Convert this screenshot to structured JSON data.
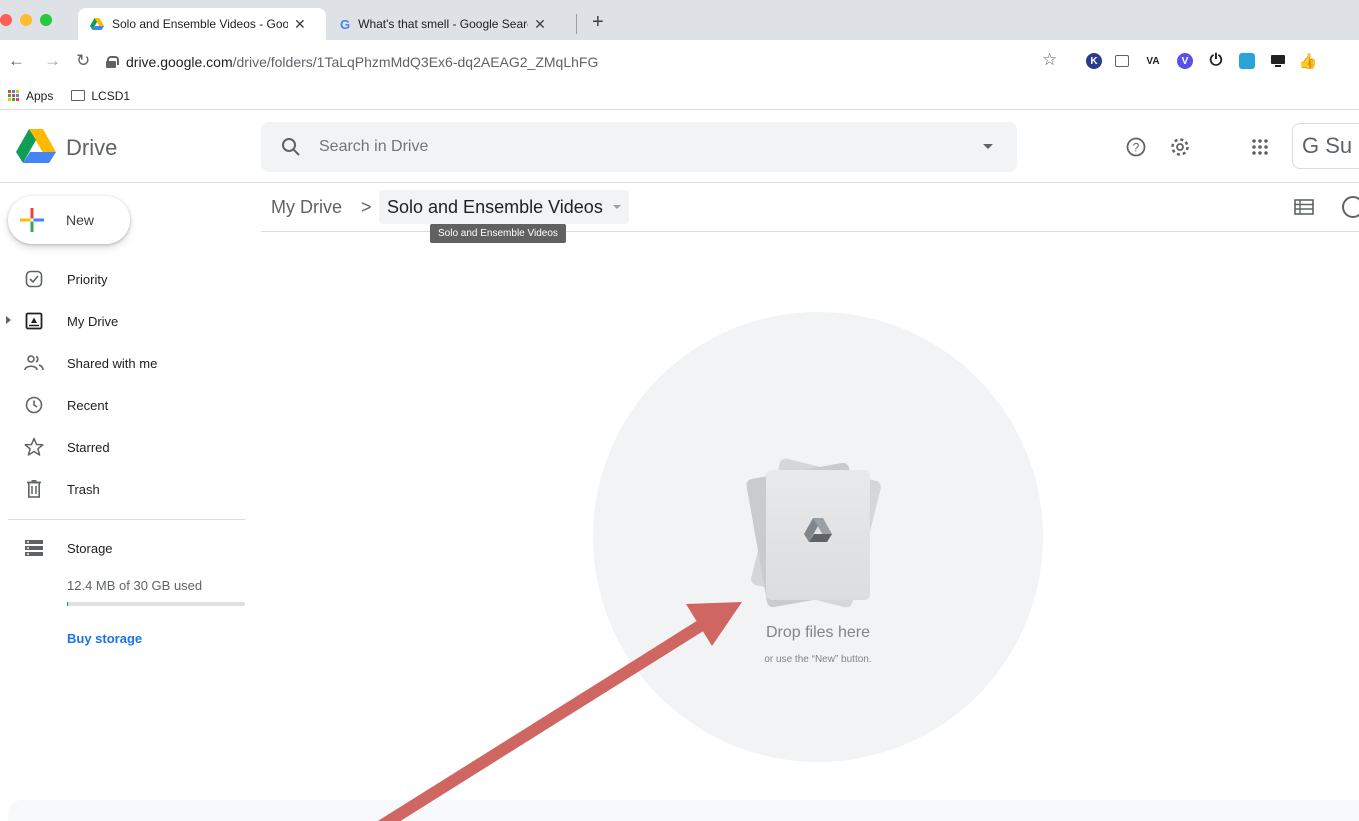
{
  "browser": {
    "tabs": [
      {
        "title": "Solo and Ensemble Videos - Google Drive",
        "active": true
      },
      {
        "title": "What's that smell - Google Search",
        "active": false
      }
    ],
    "url_host": "drive.google.com",
    "url_path": "/drive/folders/1TaLqPhzmMdQ3Ex6-dq2AEAG2_ZMqLhFG",
    "extensions": [
      "K",
      "mail-icon",
      "VA",
      "V",
      "power-icon",
      "cloud-icon",
      "screen-icon",
      "thumb-icon"
    ]
  },
  "bookmarks": {
    "apps_label": "Apps",
    "folder_label": "LCSD1"
  },
  "header": {
    "title": "Drive",
    "search_placeholder": "Search in Drive",
    "gsuite_label": "G Su"
  },
  "sidebar": {
    "new_label": "New",
    "items": [
      {
        "label": "Priority",
        "icon": "priority-icon"
      },
      {
        "label": "My Drive",
        "icon": "my-drive-icon"
      },
      {
        "label": "Shared with me",
        "icon": "shared-icon"
      },
      {
        "label": "Recent",
        "icon": "clock-icon"
      },
      {
        "label": "Starred",
        "icon": "star-icon"
      },
      {
        "label": "Trash",
        "icon": "trash-icon"
      }
    ],
    "storage_label": "Storage",
    "storage_used": "12.4 MB of 30 GB used",
    "storage_fraction": 0.0004,
    "buy_label": "Buy storage"
  },
  "breadcrumb": {
    "root": "My Drive",
    "separator": ">",
    "current": "Solo and Ensemble Videos",
    "tooltip": "Solo and Ensemble Videos"
  },
  "empty_state": {
    "title": "Drop files here",
    "subtitle": "or use the “New” button."
  },
  "colors": {
    "accent": "#1a73e8",
    "annotation_arrow": "#cf6661"
  }
}
